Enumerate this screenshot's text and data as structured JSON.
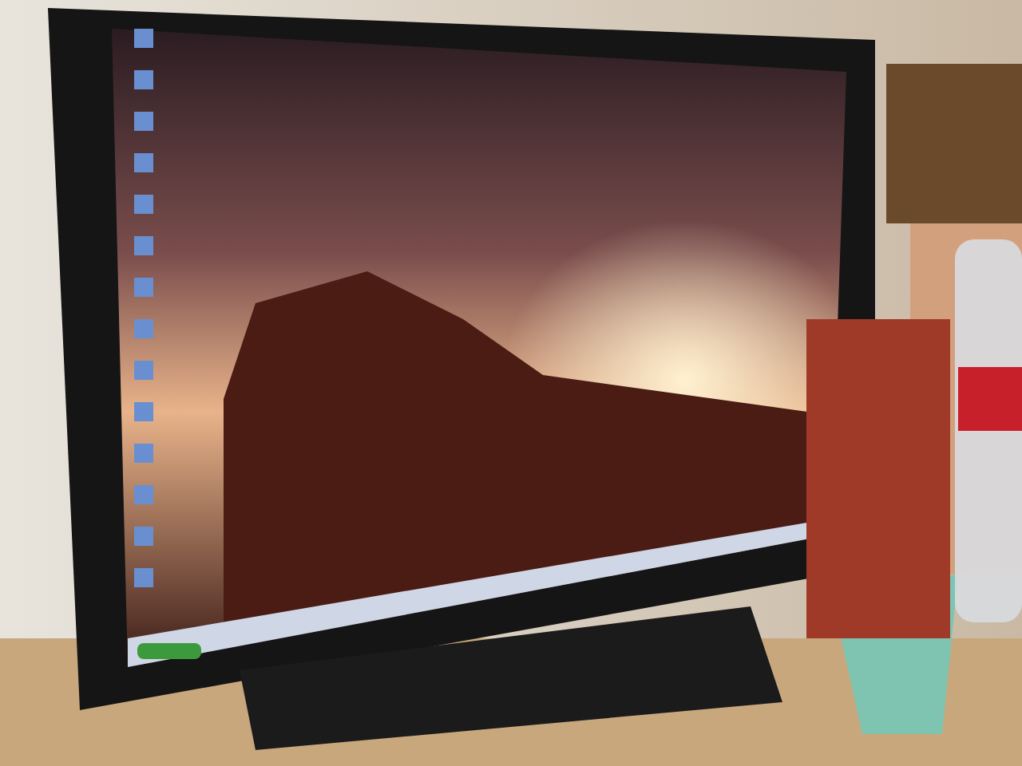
{
  "photo": {
    "kind": "monitor"
  }
}
